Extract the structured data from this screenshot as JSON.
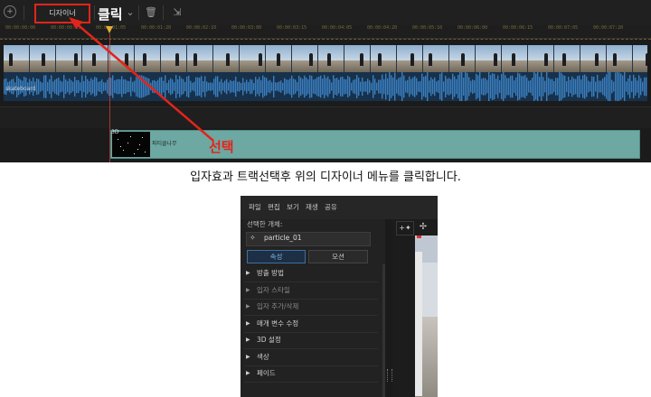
{
  "timeline": {
    "toolbar": {
      "designer_label": "디자이너",
      "click_annotation": "클릭"
    },
    "ruler_ticks": [
      "00:00:00:00",
      "00:00:00:15",
      "00:00:01:05",
      "00:00:01:20",
      "00:00:02:10",
      "00:00:03:00",
      "00:00:03:15",
      "00:00:04:05",
      "00:00:04:20",
      "00:00:05:10",
      "00:00:06:00",
      "00:00:06:15",
      "00:00:07:05",
      "00:00:07:20"
    ],
    "audio_track_label": "skateboard",
    "effect_clip": {
      "badge": "3D",
      "name": "파티클나무"
    },
    "select_annotation": "선택"
  },
  "caption": "입자효과 트랙선택후 위의 디자이너 메뉴를 클릭합니다.",
  "designer_window": {
    "menu": [
      "파일",
      "편집",
      "보기",
      "재생",
      "공유"
    ],
    "selected_object_label": "선택한 개체:",
    "selected_object_value": "particle_01",
    "tabs": {
      "properties": "속성",
      "options": "모션"
    },
    "sections": [
      {
        "label": "방출 방법",
        "enabled": true
      },
      {
        "label": "입자 스타일",
        "enabled": false
      },
      {
        "label": "입자 추가/삭제",
        "enabled": false
      },
      {
        "label": "매개 변수 수정",
        "enabled": true
      },
      {
        "label": "3D 설정",
        "enabled": true
      },
      {
        "label": "색상",
        "enabled": true
      },
      {
        "label": "페이드",
        "enabled": true
      }
    ]
  },
  "colors": {
    "annotation_red": "#e3241b",
    "effect_clip": "#6ea8a2",
    "audio_wave": "#3a7fc0",
    "tab_active": "#7cb0e0"
  }
}
